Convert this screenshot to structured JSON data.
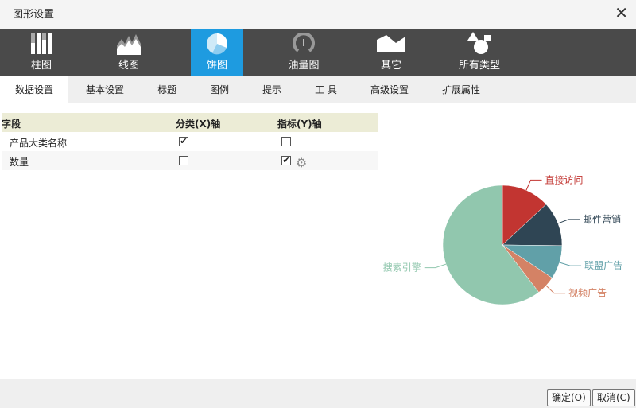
{
  "title": "图形设置",
  "chart_types": [
    {
      "label": "柱图"
    },
    {
      "label": "线图"
    },
    {
      "label": "饼图"
    },
    {
      "label": "油量图"
    },
    {
      "label": "其它"
    },
    {
      "label": "所有类型"
    }
  ],
  "tabs": [
    {
      "label": "数据设置"
    },
    {
      "label": "基本设置"
    },
    {
      "label": "标题"
    },
    {
      "label": "图例"
    },
    {
      "label": "提示"
    },
    {
      "label": "工 具"
    },
    {
      "label": "高级设置"
    },
    {
      "label": "扩展属性"
    }
  ],
  "grid": {
    "headers": [
      "字段",
      "分类(X)轴",
      "指标(Y)轴"
    ],
    "rows": [
      {
        "field": "产品大类名称",
        "x": true,
        "y": false
      },
      {
        "field": "数量",
        "x": false,
        "y": true
      }
    ]
  },
  "chart_data": {
    "type": "pie",
    "title": "",
    "series": [
      {
        "name": "直接访问",
        "value": 335,
        "color": "#c23531"
      },
      {
        "name": "邮件营销",
        "value": 310,
        "color": "#2f4554"
      },
      {
        "name": "联盟广告",
        "value": 234,
        "color": "#61a0a8"
      },
      {
        "name": "视频广告",
        "value": 135,
        "color": "#d48265"
      },
      {
        "name": "搜索引擎",
        "value": 1548,
        "color": "#91c7ae"
      }
    ]
  },
  "buttons": {
    "ok": "确定(O)",
    "cancel": "取消(C)"
  }
}
